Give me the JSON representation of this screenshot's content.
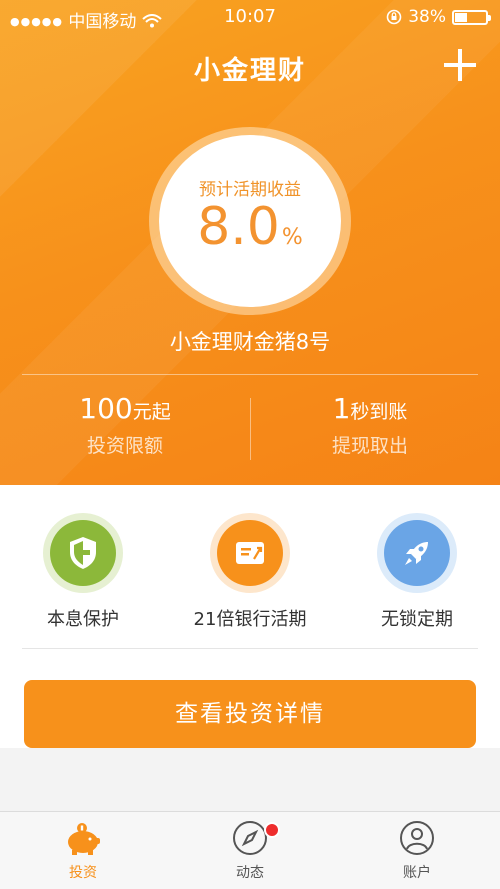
{
  "status_bar": {
    "signal_dots": "●●●●●",
    "carrier": "中国移动",
    "time": "10:07",
    "battery": "38%"
  },
  "header": {
    "title": "小金理财"
  },
  "hero": {
    "rate_label": "预计活期收益",
    "rate_value": "8.0",
    "rate_unit": "%",
    "product_name": "小金理财金猪8号",
    "stats": [
      {
        "value": "100",
        "unit": "元起",
        "caption": "投资限额"
      },
      {
        "value": "1",
        "unit": "秒到账",
        "caption": "提现取出"
      }
    ]
  },
  "features": [
    {
      "label": "本息保护",
      "icon": "shield-icon",
      "color": "#8cb83a",
      "halo": "#e6f0d2"
    },
    {
      "label": "21倍银行活期",
      "icon": "transfer-card-icon",
      "color": "#f7911b",
      "halo": "#fde6cc"
    },
    {
      "label": "无锁定期",
      "icon": "rocket-icon",
      "color": "#6aa5e6",
      "halo": "#dcebfa"
    }
  ],
  "cta": {
    "label": "查看投资详情"
  },
  "tabbar": {
    "tabs": [
      {
        "label": "投资",
        "icon": "piggy-bank-icon",
        "active": true
      },
      {
        "label": "动态",
        "icon": "compass-icon",
        "active": false,
        "badge": true
      },
      {
        "label": "账户",
        "icon": "user-icon",
        "active": false
      }
    ]
  },
  "colors": {
    "accent": "#f7911b",
    "badge": "#ee2d2d"
  }
}
